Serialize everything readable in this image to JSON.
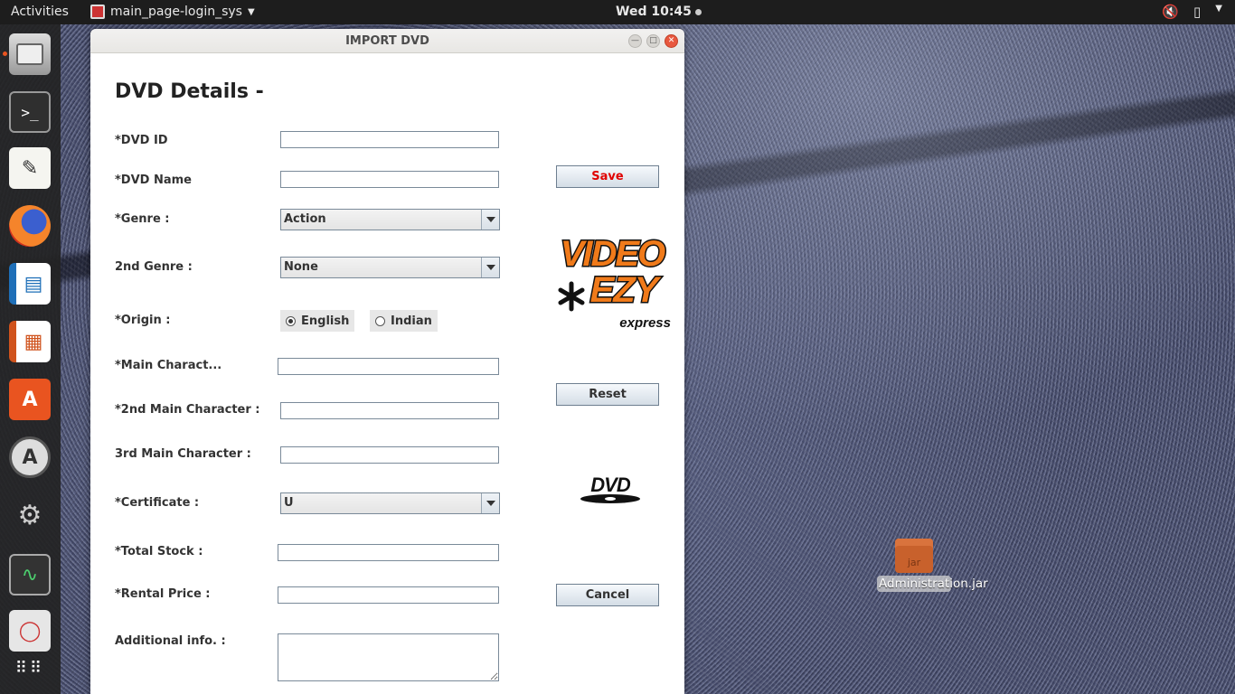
{
  "topbar": {
    "activities": "Activities",
    "app_name": "main_page-login_sys",
    "clock": "Wed 10:45"
  },
  "desktop": {
    "file_icon_label": "jar",
    "file_name": "Administration.jar"
  },
  "window": {
    "title": "IMPORT DVD",
    "heading": "DVD Details -",
    "fields": {
      "dvd_id_label": "*DVD ID",
      "dvd_id_value": "",
      "dvd_name_label": "*DVD Name",
      "dvd_name_value": "",
      "genre_label": "*Genre :",
      "genre_value": "Action",
      "genre2_label": "2nd Genre :",
      "genre2_value": "None",
      "origin_label": "*Origin :",
      "origin_options": [
        "English",
        "Indian"
      ],
      "origin_selected": "English",
      "main_char_label": "*Main Charact...",
      "main_char_value": "",
      "main_char2_label": "*2nd Main Character :",
      "main_char2_value": "",
      "main_char3_label": "3rd Main Character :",
      "main_char3_value": "",
      "certificate_label": "*Certificate :",
      "certificate_value": "U",
      "total_stock_label": "*Total Stock :",
      "total_stock_value": "",
      "rental_price_label": "*Rental Price :",
      "rental_price_value": "",
      "additional_info_label": "Additional info. :",
      "additional_info_value": ""
    },
    "buttons": {
      "save": "Save",
      "reset": "Reset",
      "cancel": "Cancel"
    },
    "logo": {
      "line1": "VIDEO",
      "line2": "EZY",
      "line3": "express",
      "dvd": "DVD"
    }
  },
  "colors": {
    "save_text": "#e00000",
    "close_button": "#e8583f",
    "topbar_bg": "#1d1d1d",
    "logo_orange": "#f07a1a"
  }
}
